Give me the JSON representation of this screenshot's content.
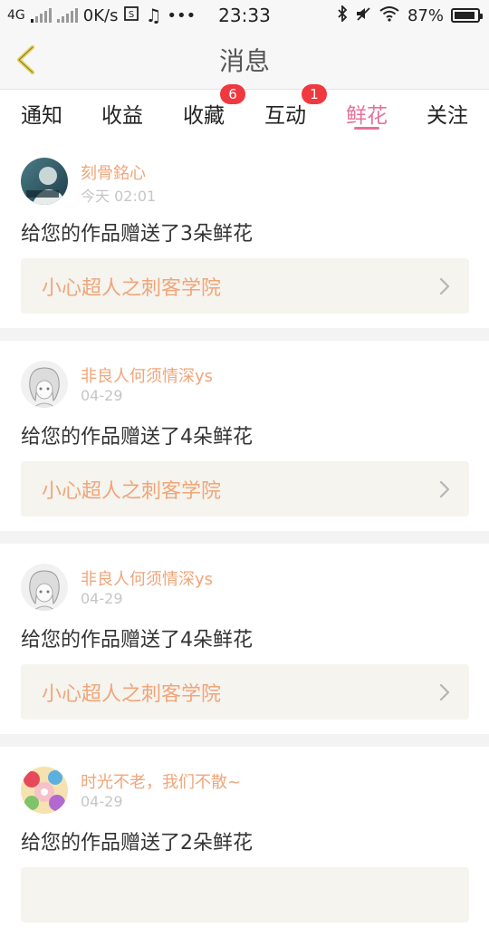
{
  "status_bar": {
    "network": "4G",
    "speed": "0K/s",
    "time": "23:33",
    "battery": "87%",
    "battery_level": 0.87
  },
  "header": {
    "title": "消息"
  },
  "tabs": [
    {
      "label": "通知",
      "badge": ""
    },
    {
      "label": "收益",
      "badge": ""
    },
    {
      "label": "收藏",
      "badge": "6"
    },
    {
      "label": "互动",
      "badge": "1"
    },
    {
      "label": "鲜花",
      "badge": "",
      "active": true
    },
    {
      "label": "关注",
      "badge": ""
    }
  ],
  "colors": {
    "accent": "#e8709a",
    "name": "#f0a57a",
    "badge": "#f0383f"
  },
  "messages": [
    {
      "user": "刻骨銘心",
      "time": "今天 02:01",
      "text": "给您的作品赠送了3朵鲜花",
      "work": "小心超人之刺客学院",
      "avatar_icon": "avatar-photo-icon"
    },
    {
      "user": "非良人何须情深ys",
      "time": "04-29",
      "text": "给您的作品赠送了4朵鲜花",
      "work": "小心超人之刺客学院",
      "avatar_icon": "avatar-sketch-girl-icon"
    },
    {
      "user": "非良人何须情深ys",
      "time": "04-29",
      "text": "给您的作品赠送了4朵鲜花",
      "work": "小心超人之刺客学院",
      "avatar_icon": "avatar-sketch-girl-icon"
    },
    {
      "user": "时光不老，我们不散~",
      "time": "04-29",
      "text": "给您的作品赠送了2朵鲜花",
      "work": "",
      "avatar_icon": "avatar-colorful-icon"
    }
  ]
}
